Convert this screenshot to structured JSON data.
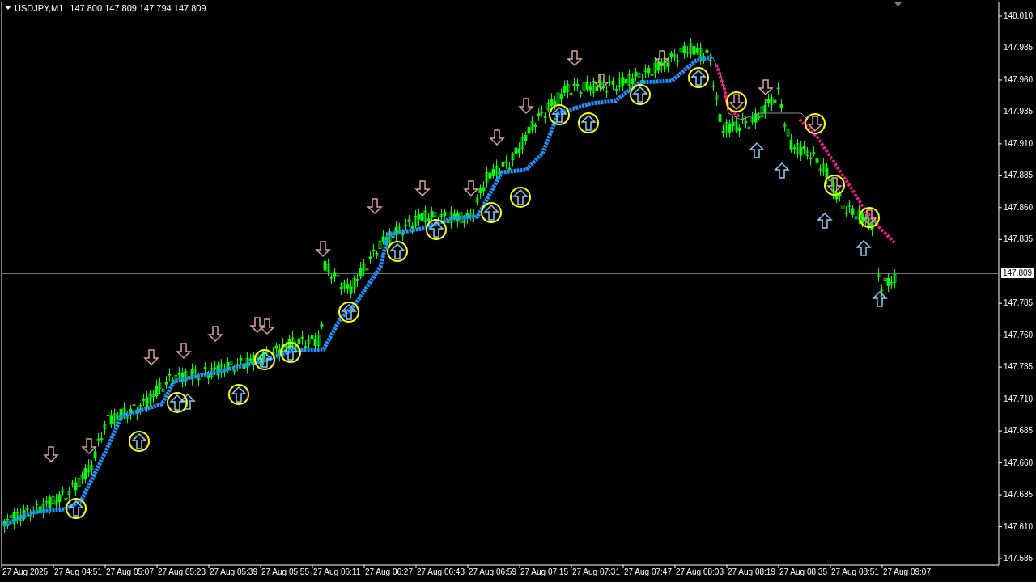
{
  "chart": {
    "symbol": "USDJPY,M1",
    "ohlc": "147.800 147.809 147.794 147.809"
  },
  "price_axis": {
    "labels": [
      "148.010",
      "147.985",
      "147.960",
      "147.935",
      "147.910",
      "147.885",
      "147.860",
      "147.835",
      "147.785",
      "147.760",
      "147.735",
      "147.710",
      "147.685",
      "147.660",
      "147.635",
      "147.610",
      "147.585"
    ],
    "current_price": "147.809"
  },
  "time_axis": {
    "labels": [
      "27 Aug 2025",
      "27 Aug 04:51",
      "27 Aug 05:07",
      "27 Aug 05:23",
      "27 Aug 05:39",
      "27 Aug 05:55",
      "27 Aug 06:11",
      "27 Aug 06:27",
      "27 Aug 06:43",
      "27 Aug 06:59",
      "27 Aug 07:15",
      "27 Aug 07:31",
      "27 Aug 07:47",
      "27 Aug 08:03",
      "27 Aug 08:19",
      "27 Aug 08:35",
      "27 Aug 08:51",
      "27 Aug 09:07"
    ]
  }
}
